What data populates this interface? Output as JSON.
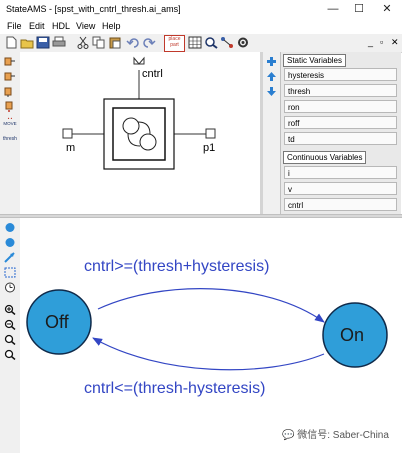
{
  "app": {
    "title": "StateAMS - [spst_with_cntrl_thresh.ai_ams]",
    "window_buttons": {
      "minimize": "—",
      "maximize": "☐",
      "close": "✕"
    }
  },
  "menu": [
    "File",
    "Edit",
    "HDL",
    "View",
    "Help"
  ],
  "doc_buttons": {
    "minimize": "_",
    "restore": "▫",
    "close": "✕"
  },
  "toolbar_icons": [
    "new-icon",
    "open-icon",
    "save-icon",
    "print-icon",
    "cut-icon",
    "copy-icon",
    "paste-icon",
    "undo-icon",
    "redo-icon",
    "place-part-icon",
    "grid-icon",
    "zoom-icon",
    "connect-icon",
    "settings-icon"
  ],
  "toolbar_text": {
    "place_part": "place part"
  },
  "left_tools": {
    "label_1": "MOVE",
    "label_2": "thresh"
  },
  "symbol": {
    "control_pin": "cntrl",
    "left_pin": "m",
    "right_pin": "p1"
  },
  "variables": {
    "static_header": "Static Variables",
    "static_items": [
      "hysteresis",
      "thresh",
      "ron",
      "roff",
      "td"
    ],
    "continuous_header": "Continuous Variables",
    "continuous_items": [
      "i",
      "v",
      "cntrl"
    ]
  },
  "state_diagram": {
    "states": [
      {
        "name": "Off"
      },
      {
        "name": "On"
      }
    ],
    "transitions": [
      {
        "from": "Off",
        "to": "On",
        "condition": "cntrl>=(thresh+hysteresis)"
      },
      {
        "from": "On",
        "to": "Off",
        "condition": "cntrl<=(thresh-hysteresis)"
      }
    ],
    "state_color": "#2f9ed9",
    "transition_color": "#3346c4"
  },
  "watermark": {
    "text": "微信号: Saber-China"
  }
}
